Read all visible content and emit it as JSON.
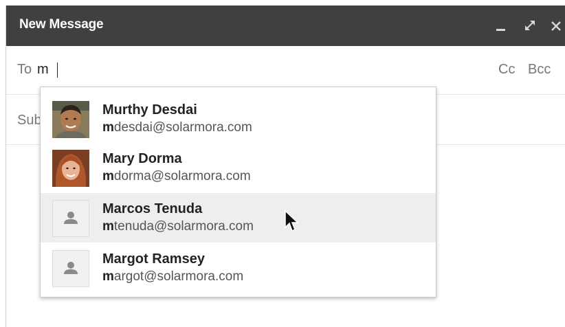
{
  "window": {
    "title": "New Message"
  },
  "recipients": {
    "to_label": "To",
    "to_value": "m",
    "cc_label": "Cc",
    "bcc_label": "Bcc"
  },
  "subject": {
    "label_visible": "Sub"
  },
  "suggestions": [
    {
      "name": "Murthy Desdai",
      "email_match": "m",
      "email_rest": "desdai@solarmora.com",
      "avatar": "photo-man"
    },
    {
      "name": "Mary Dorma",
      "email_match": "m",
      "email_rest": "dorma@solarmora.com",
      "avatar": "photo-woman"
    },
    {
      "name": "Marcos Tenuda",
      "email_match": "m",
      "email_rest": "tenuda@solarmora.com",
      "avatar": "person-icon"
    },
    {
      "name": "Margot Ramsey",
      "email_match": "m",
      "email_rest": "argot@solarmora.com",
      "avatar": "person-icon"
    }
  ],
  "colors": {
    "titlebar": "#404040",
    "highlight": "#eeeeee",
    "label_gray": "#777777"
  },
  "icons": {
    "minimize": "minimize-icon",
    "maximize": "expand-icon",
    "close": "close-icon",
    "placeholder_avatar": "person-icon",
    "pointer": "mouse-pointer-icon"
  }
}
